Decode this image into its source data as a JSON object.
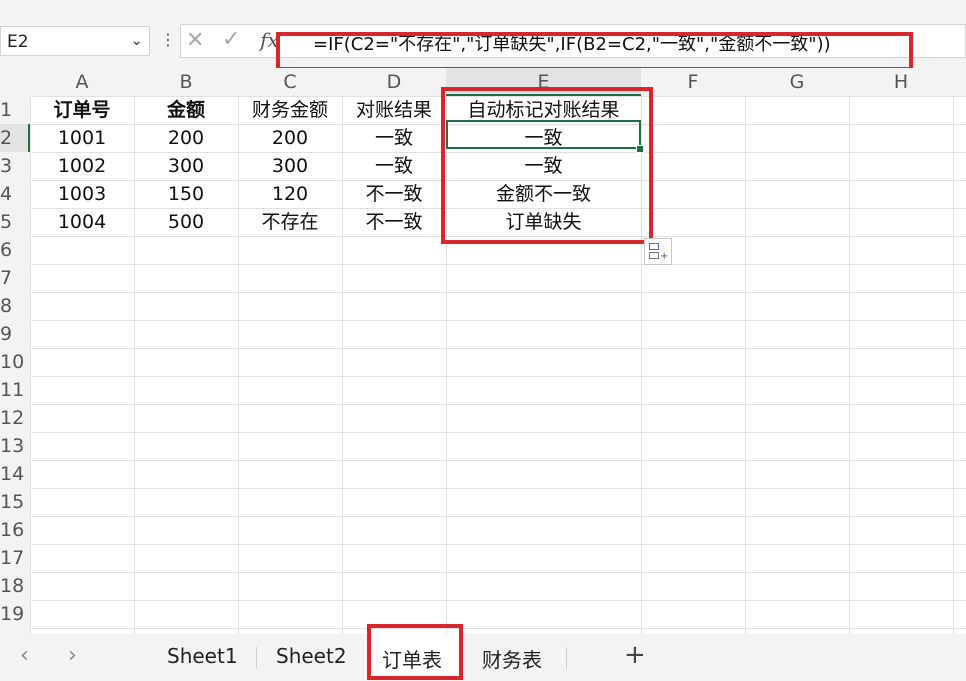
{
  "formula_bar": {
    "name_box": "E2",
    "fx_label": "fx",
    "formula": "=IF(C2=\"不存在\",\"订单缺失\",IF(B2=C2,\"一致\",\"金额不一致\"))"
  },
  "columns": [
    "A",
    "B",
    "C",
    "D",
    "E",
    "F",
    "G",
    "H"
  ],
  "rows": [
    "1",
    "2",
    "3",
    "4",
    "5",
    "6",
    "7",
    "8",
    "9",
    "10",
    "11",
    "12",
    "13",
    "14",
    "15",
    "16",
    "17",
    "18",
    "19"
  ],
  "table": {
    "headers": [
      "订单号",
      "金额",
      "财务金额",
      "对账结果",
      "自动标记对账结果"
    ],
    "data": [
      [
        "1001",
        "200",
        "200",
        "一致",
        "一致"
      ],
      [
        "1002",
        "300",
        "300",
        "一致",
        "一致"
      ],
      [
        "1003",
        "150",
        "120",
        "不一致",
        "金额不一致"
      ],
      [
        "1004",
        "500",
        "不存在",
        "不一致",
        "订单缺失"
      ]
    ]
  },
  "selected_cell": "E2",
  "sheet_tabs": [
    "Sheet1",
    "Sheet2",
    "订单表",
    "财务表"
  ],
  "active_sheet": "订单表",
  "icons": {
    "prev": "chevron-left-icon",
    "next": "chevron-right-icon",
    "add": "plus-icon",
    "cancel": "cross-icon",
    "confirm": "check-icon",
    "autofill": "auto-fill-options-icon"
  },
  "colors": {
    "selection": "#1f7145",
    "annotation": "#d8262a"
  }
}
